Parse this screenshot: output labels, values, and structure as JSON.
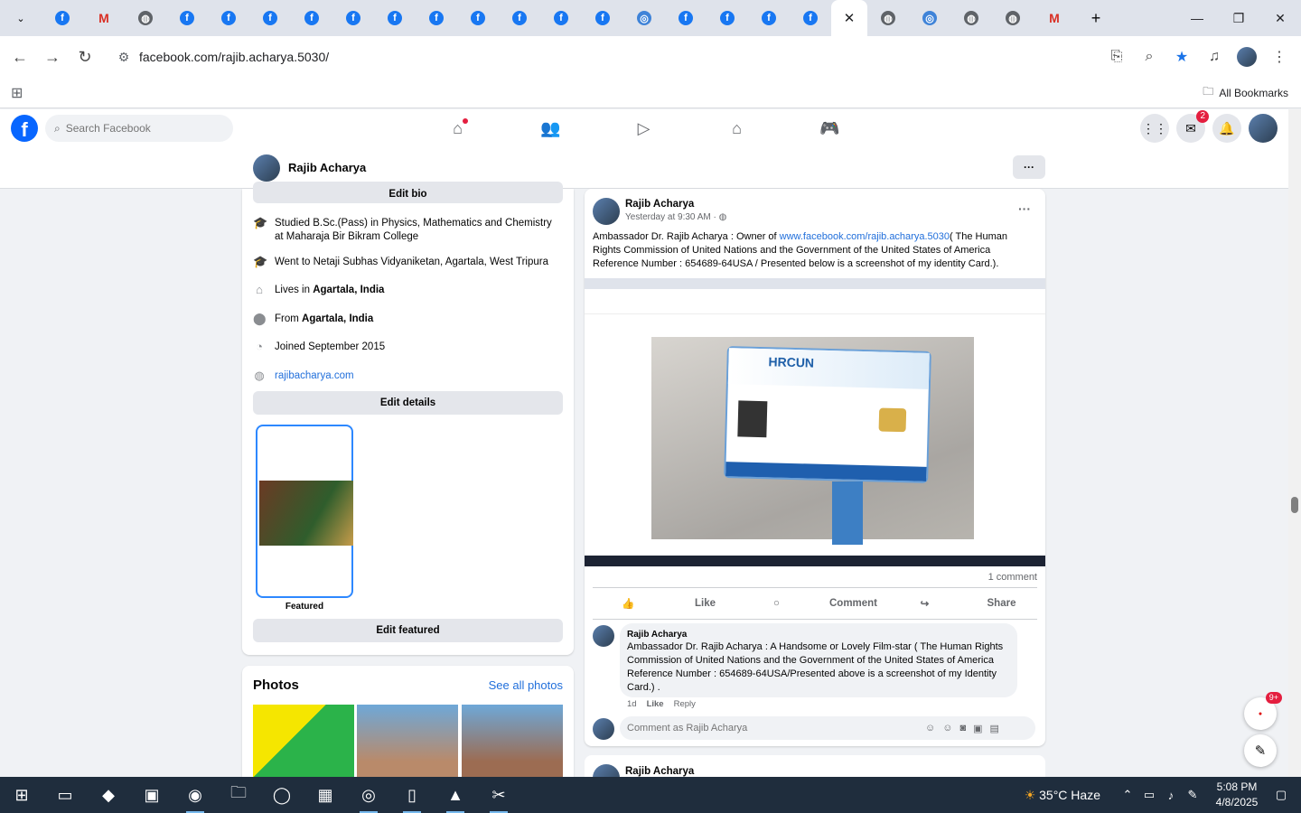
{
  "browser": {
    "active_tab_close": "✕",
    "new_tab": "+",
    "url": "facebook.com/rajib.acharya.5030/",
    "all_bookmarks": "All Bookmarks"
  },
  "facebook": {
    "logo_letter": "f",
    "search_placeholder": "Search Facebook",
    "messenger_badge": "2"
  },
  "profile": {
    "name": "Rajib Acharya",
    "more_label": "···"
  },
  "intro": {
    "edit_bio": "Edit bio",
    "items": [
      {
        "icon": "graduation-cap-icon",
        "text": "Studied B.Sc.(Pass) in Physics, Mathematics and Chemistry at Maharaja Bir Bikram College"
      },
      {
        "icon": "graduation-cap-icon",
        "text": "Went to Netaji Subhas Vidyaniketan, Agartala, West Tripura"
      },
      {
        "icon": "home-icon",
        "text_prefix": "Lives in ",
        "text_bold": "Agartala, India"
      },
      {
        "icon": "location-pin-icon",
        "text_prefix": "From ",
        "text_bold": "Agartala, India"
      },
      {
        "icon": "clock-icon",
        "text": "Joined September 2015"
      },
      {
        "icon": "globe-icon",
        "link": "rajibacharya.com"
      }
    ],
    "edit_details": "Edit details",
    "featured_label": "Featured",
    "edit_featured": "Edit featured"
  },
  "photos": {
    "title": "Photos",
    "see_all": "See all photos"
  },
  "post": {
    "author": "Rajib Acharya",
    "time": "Yesterday at 9:30 AM",
    "privacy_icon": "globe-icon",
    "text_before_link": "Ambassador Dr. Rajib Acharya : Owner of ",
    "link": "www.facebook.com/rajib.acharya.5030",
    "text_after_link": "( The Human Rights Commission of United Nations and the Government of the United  States of America Reference Number : 654689-64USA / Presented below is a screenshot of my identity Card.).",
    "id_card_org": "HRCUN",
    "comment_count": "1 comment",
    "like": "Like",
    "comment": "Comment",
    "share": "Share",
    "comment_author": "Rajib Acharya",
    "comment_text": "Ambassador Dr. Rajib Acharya : A Handsome or Lovely Film-star ( The Human Rights Commission of United Nations and the Government of the United States of America Reference Number : 654689-64USA/Presented above is a screenshot of my Identity Card.) .",
    "comment_age": "1d",
    "comment_like": "Like",
    "comment_reply": "Reply",
    "write_placeholder": "Comment as Rajib Acharya"
  },
  "post2": {
    "author": "Rajib Acharya"
  },
  "floating": {
    "badge": "9+",
    "compose_icon": "edit-icon"
  },
  "taskbar": {
    "weather": "35°C  Haze",
    "time": "5:08 PM",
    "date": "4/8/2025"
  },
  "colors": {
    "facebook_blue": "#0866ff",
    "link_blue": "#216fdb",
    "notification_red": "#e41e3f"
  }
}
